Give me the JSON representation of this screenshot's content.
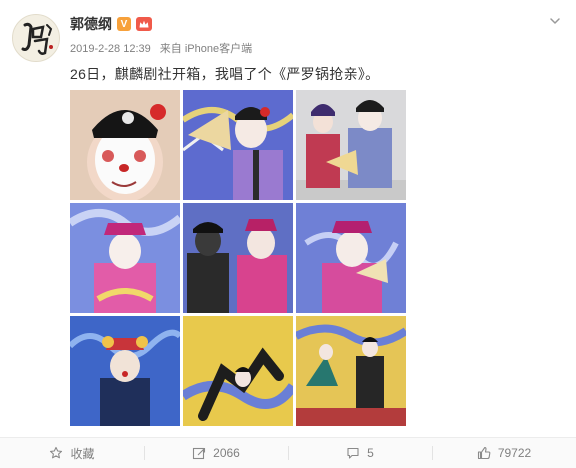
{
  "user": {
    "name": "郭德纲",
    "verified_badge": "V",
    "avatar_text": "郭",
    "avatar_icon": "calligraphy-logo"
  },
  "post": {
    "time": "2019-2-28 12:39",
    "source_prefix": "来自",
    "source": "iPhone客户端",
    "text": "26日，麒麟剧社开箱，我唱了个《严罗锅抢亲》。"
  },
  "photos": [
    {
      "label": "photo-1",
      "scene": "clown-closeup"
    },
    {
      "label": "photo-2",
      "scene": "clown-fan"
    },
    {
      "label": "photo-3",
      "scene": "couple-stage"
    },
    {
      "label": "photo-4",
      "scene": "official-pink"
    },
    {
      "label": "photo-5",
      "scene": "two-actors"
    },
    {
      "label": "photo-6",
      "scene": "official-pink-2"
    },
    {
      "label": "photo-7",
      "scene": "clown-crown"
    },
    {
      "label": "photo-8",
      "scene": "acrobat-yellow"
    },
    {
      "label": "photo-9",
      "scene": "stage-fight"
    }
  ],
  "actions": {
    "favorite": {
      "label": "收藏",
      "icon": "star-icon"
    },
    "repost": {
      "label": "2066",
      "icon": "repost-icon"
    },
    "comment": {
      "label": "5",
      "icon": "comment-icon"
    },
    "like": {
      "label": "79722",
      "icon": "thumbs-up-icon"
    }
  },
  "colors": {
    "text": "#333333",
    "meta": "#808080",
    "vip_orange": "#f7a13b",
    "crown_red": "#f05a4a"
  }
}
